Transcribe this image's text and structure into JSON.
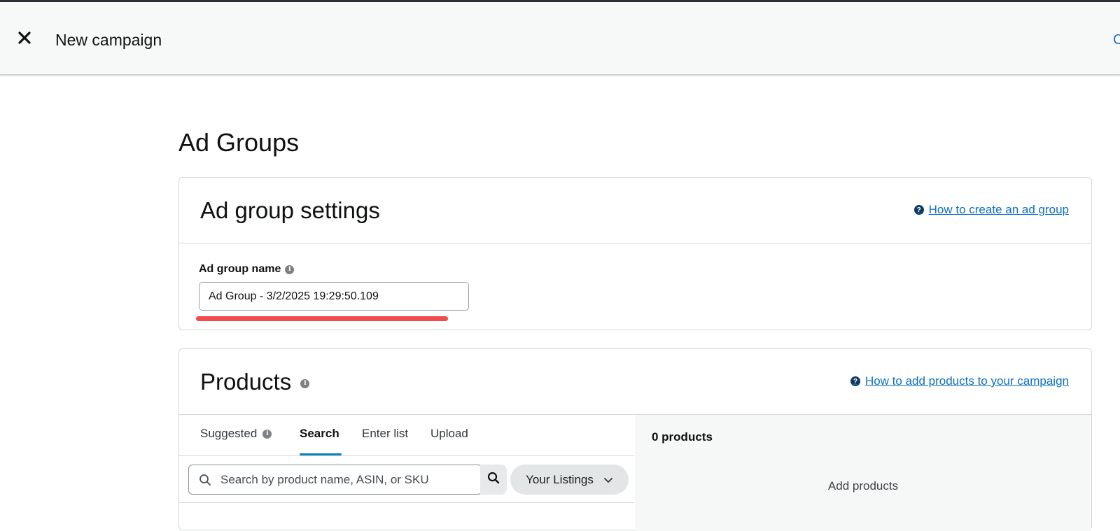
{
  "header": {
    "title": "New campaign",
    "edge_link": "C"
  },
  "page": {
    "title": "Ad Groups"
  },
  "settings": {
    "title": "Ad group settings",
    "help_link": "How to create an ad group",
    "name_label": "Ad group name",
    "name_value": "Ad Group - 3/2/2025 19:29:50.109"
  },
  "products": {
    "title": "Products",
    "help_link": "How to add products to your campaign",
    "tabs": [
      {
        "label": "Suggested"
      },
      {
        "label": "Search"
      },
      {
        "label": "Enter list"
      },
      {
        "label": "Upload"
      }
    ],
    "active_tab": "Search",
    "search": {
      "placeholder": "Search by product name, ASIN, or SKU",
      "filter_label": "Your Listings"
    },
    "selected_count": "0 products",
    "empty_text": "Add products"
  },
  "colors": {
    "link": "#0c6fc0",
    "annotation_underline": "#f24b4b",
    "tab_underline": "#0a7fbf"
  },
  "icons": [
    "close-icon",
    "help-circle-icon",
    "info-icon",
    "search-icon",
    "chevron-down-icon"
  ]
}
